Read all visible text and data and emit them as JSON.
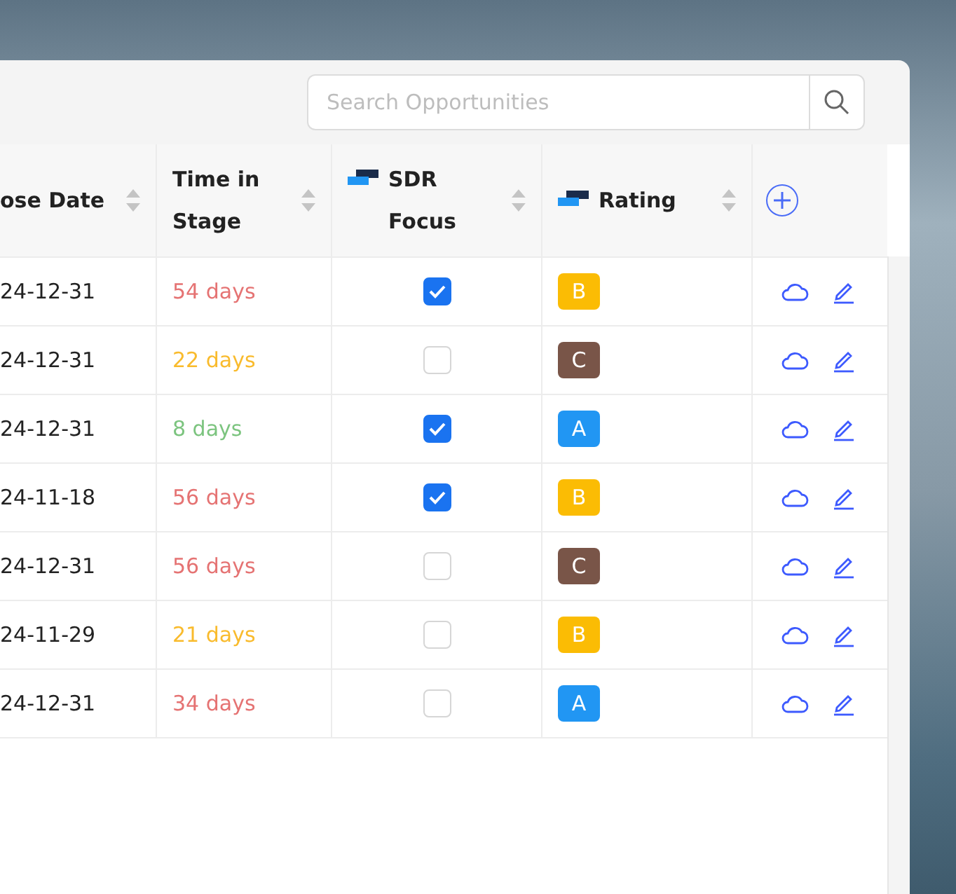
{
  "search": {
    "placeholder": "Search Opportunities"
  },
  "table": {
    "columns": [
      {
        "kind": "sort",
        "label": "ose Date"
      },
      {
        "kind": "sort",
        "label": "Time in Stage"
      },
      {
        "kind": "sort_icon",
        "label": "SDR Focus"
      },
      {
        "kind": "sort_icon",
        "label": "Rating"
      },
      {
        "kind": "add"
      }
    ],
    "rows": [
      {
        "close_date": "24-12-31",
        "time_in_stage": {
          "text": "54 days",
          "color": "#e57373"
        },
        "sdr_focus": true,
        "rating": {
          "label": "B",
          "color": "#fbbc04"
        }
      },
      {
        "close_date": "24-12-31",
        "time_in_stage": {
          "text": "22 days",
          "color": "#f9bb2d"
        },
        "sdr_focus": false,
        "rating": {
          "label": "C",
          "color": "#795548"
        }
      },
      {
        "close_date": "24-12-31",
        "time_in_stage": {
          "text": "8 days",
          "color": "#7cc47f"
        },
        "sdr_focus": true,
        "rating": {
          "label": "A",
          "color": "#2196f3"
        }
      },
      {
        "close_date": "24-11-18",
        "time_in_stage": {
          "text": "56 days",
          "color": "#e57373"
        },
        "sdr_focus": true,
        "rating": {
          "label": "B",
          "color": "#fbbc04"
        }
      },
      {
        "close_date": "24-12-31",
        "time_in_stage": {
          "text": "56 days",
          "color": "#e57373"
        },
        "sdr_focus": false,
        "rating": {
          "label": "C",
          "color": "#795548"
        }
      },
      {
        "close_date": "24-11-29",
        "time_in_stage": {
          "text": "21 days",
          "color": "#f9bb2d"
        },
        "sdr_focus": false,
        "rating": {
          "label": "B",
          "color": "#fbbc04"
        }
      },
      {
        "close_date": "24-12-31",
        "time_in_stage": {
          "text": "34 days",
          "color": "#e57373"
        },
        "sdr_focus": false,
        "rating": {
          "label": "A",
          "color": "#2196f3"
        }
      }
    ]
  }
}
